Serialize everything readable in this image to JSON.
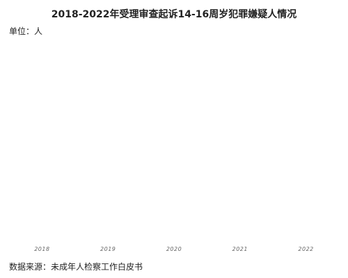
{
  "chart_data": {
    "type": "bar",
    "title": "2018-2022年受理审查起诉14-16周岁犯罪嫌疑人情况",
    "unit": "单位：人",
    "source": "数据来源：未成年人检察工作白皮书",
    "categories": [
      "2018",
      "2019",
      "2020",
      "2021",
      "2022"
    ],
    "values": [],
    "legend": "none",
    "grid": false
  }
}
